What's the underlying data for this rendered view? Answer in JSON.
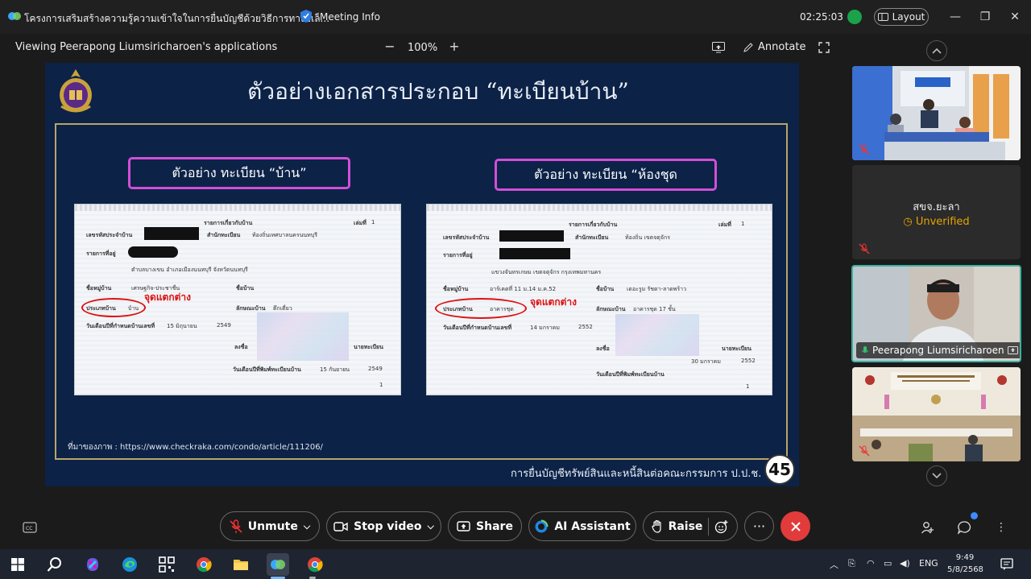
{
  "window": {
    "title": "โครงการเสริมสร้างความรู้ความเข้าใจในการยื่นบัญชีด้วยวิธีการทางอิเล็...",
    "meeting_info": "Meeting Info",
    "elapsed": "02:25:03",
    "layout_label": "Layout"
  },
  "share_bar": {
    "viewing": "Viewing Peerapong Liumsiricharoen's applications",
    "zoom_minus": "−",
    "zoom": "100%",
    "zoom_plus": "+",
    "annotate": "Annotate"
  },
  "slide": {
    "title": "ตัวอย่างเอกสารประกอบ “ทะเบียนบ้าน”",
    "left_label": "ตัวอย่าง ทะเบียน “บ้าน”",
    "right_label": "ตัวอย่าง ทะเบียน “ห้องชุด",
    "left_doc": {
      "header": "รายการเกี่ยวกับบ้าน",
      "page_label": "เล่มที่",
      "page_no": "1",
      "house_id_label": "เลขรหัสประจำบ้าน",
      "office_label": "สำนักทะเบียน",
      "office_value": "ท้องถิ่นเทศบาลนครนนทบุรี",
      "address_label": "รายการที่อยู่",
      "address_value": "ตำบลบางเขน อำเภอเมืองนนทบุรี จังหวัดนนทบุรี",
      "village_label": "ชื่อหมู่บ้าน",
      "village_value": "เศรษฐกิจ-ประชาชื่น",
      "house_name_label": "ชื่อบ้าน",
      "type_label": "ประเภทบ้าน",
      "type_value": "บ้าน",
      "diff_label": "จุดแตกต่าง",
      "style_label": "ลักษณะบ้าน",
      "style_value": "ตึกเดี่ยว",
      "date_label": "วันเดือนปีที่กำหนดบ้านเลขที่",
      "date_value": "15 มิถุนายน",
      "date_year": "2549",
      "sign_label": "ลงชื่อ",
      "registrar_label": "นายทะเบียน",
      "print_label": "วันเดือนปีที่พิมพ์ทะเบียนบ้าน",
      "print_value": "15 กันยายน",
      "print_year": "2549",
      "footer_no": "1"
    },
    "right_doc": {
      "header": "รายการเกี่ยวกับบ้าน",
      "page_label": "เล่มที่",
      "page_no": "1",
      "house_id_label": "เลขรหัสประจำบ้าน",
      "office_label": "สำนักทะเบียน",
      "office_value": "ท้องถิ่น เขตจตุจักร",
      "address_label": "รายการที่อยู่",
      "address_value": "แขวงจันทรเกษม เขตจตุจักร กรุงเทพมหานคร",
      "village_label": "ชื่อหมู่บ้าน",
      "village_value": "อาร์เคดที่ 11 ม.14 ม.ค.52",
      "house_name_label": "ชื่อบ้าน",
      "house_name_value": "เดอะรูม รัชดา-ลาดพร้าว",
      "type_label": "ประเภทบ้าน",
      "type_value": "อาคารชุด",
      "diff_label": "จุดแตกต่าง",
      "style_label": "ลักษณะบ้าน",
      "style_value": "อาคารชุด 17 ชั้น",
      "date_label": "วันเดือนปีที่กำหนดบ้านเลขที่",
      "date_value": "14 มกราคม",
      "date_year": "2552",
      "sign_label": "ลงชื่อ",
      "registrar_label": "นายทะเบียน",
      "sign_date": "30 มกราคม",
      "sign_year": "2552",
      "print_label": "วันเดือนปีที่พิมพ์ทะเบียนบ้าน",
      "footer_no": "1"
    },
    "source": "ที่มาของภาพ : https://www.checkraka.com/condo/article/111206/",
    "footer": "การยื่นบัญชีทรัพย์สินและหนี้สินต่อคณะกรรมการ ป.ป.ช.",
    "page_number": "45"
  },
  "participants": [
    {
      "kind": "video-room"
    },
    {
      "kind": "no-video",
      "name": "สขจ.ยะลา",
      "status": "Unverified"
    },
    {
      "kind": "speaker",
      "name": "Peerapong Liumsiricharoen"
    },
    {
      "kind": "video-hall"
    }
  ],
  "controls": {
    "unmute": "Unmute",
    "stop_video": "Stop video",
    "share": "Share",
    "ai_assistant": "AI Assistant",
    "raise": "Raise",
    "more": "···"
  },
  "taskbar": {
    "language": "ENG",
    "time": "9:49",
    "date": "5/8/2568"
  },
  "colors": {
    "slide_bg": "#0c2247",
    "label_border": "#d14fd6",
    "leave_button": "#e23b3b",
    "active_speaker_border": "#3cb0a0",
    "unverified": "#e6a400"
  }
}
